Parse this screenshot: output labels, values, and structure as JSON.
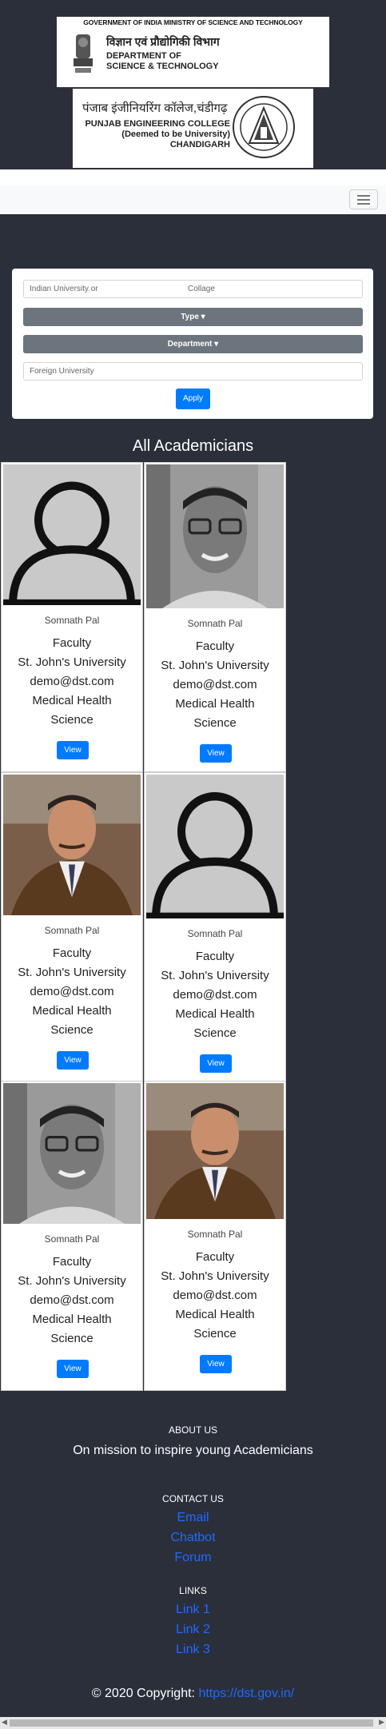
{
  "header": {
    "dst_top": "GOVERNMENT OF INDIA   MINISTRY OF SCIENCE AND TECHNOLOGY",
    "dst_hindi": "विज्ञान एवं प्रौद्योगिकी विभाग",
    "dst_line1": "DEPARTMENT OF",
    "dst_line2": "SCIENCE & TECHNOLOGY",
    "pec_hindi": "पंजाब इंजीनियरिंग कॉलेज,चंडीगढ़",
    "pec_line1": "PUNJAB ENGINEERING COLLEGE",
    "pec_line2": "(Deemed to be University)",
    "pec_line3": "CHANDIGARH"
  },
  "filters": {
    "university_placeholder_a": "Indian University or",
    "university_placeholder_b": "Collage",
    "type_label": "Type",
    "department_label": "Department",
    "foreign_placeholder": "Foreign University",
    "apply_label": "Apply"
  },
  "section_title": "All Academicians",
  "cards": [
    {
      "photo": "placeholder-avatar",
      "name": "Somnath Pal",
      "role": "Faculty",
      "university": "St. John's University",
      "email": "demo@dst.com",
      "dept1": "Medical Health",
      "dept2": "Science",
      "view": "View"
    },
    {
      "photo": "man-glasses-photo",
      "name": "Somnath Pal",
      "role": "Faculty",
      "university": "St. John's University",
      "email": "demo@dst.com",
      "dept1": "Medical Health",
      "dept2": "Science",
      "view": "View"
    },
    {
      "photo": "man-suit-photo",
      "name": "Somnath Pal",
      "role": "Faculty",
      "university": "St. John's University",
      "email": "demo@dst.com",
      "dept1": "Medical Health",
      "dept2": "Science",
      "view": "View"
    },
    {
      "photo": "placeholder-avatar",
      "name": "Somnath Pal",
      "role": "Faculty",
      "university": "St. John's University",
      "email": "demo@dst.com",
      "dept1": "Medical Health",
      "dept2": "Science",
      "view": "View"
    },
    {
      "photo": "man-glasses-photo",
      "name": "Somnath Pal",
      "role": "Faculty",
      "university": "St. John's University",
      "email": "demo@dst.com",
      "dept1": "Medical Health",
      "dept2": "Science",
      "view": "View"
    },
    {
      "photo": "man-suit-photo",
      "name": "Somnath Pal",
      "role": "Faculty",
      "university": "St. John's University",
      "email": "demo@dst.com",
      "dept1": "Medical Health",
      "dept2": "Science",
      "view": "View"
    }
  ],
  "footer": {
    "about_heading": "ABOUT US",
    "about_text": "On mission to inspire young Academicians",
    "contact_heading": "CONTACT US",
    "contact_links": [
      "Email",
      "Chatbot",
      "Forum"
    ],
    "links_heading": "LINKS",
    "links": [
      "Link 1",
      "Link 2",
      "Link 3"
    ],
    "copyright_prefix": "© 2020 Copyright:",
    "copyright_link": "https://dst.gov.in/"
  },
  "colors": {
    "page_bg": "#2b2f3a",
    "primary": "#007bff",
    "secondary": "#6c757d",
    "link": "#1e6bff"
  }
}
